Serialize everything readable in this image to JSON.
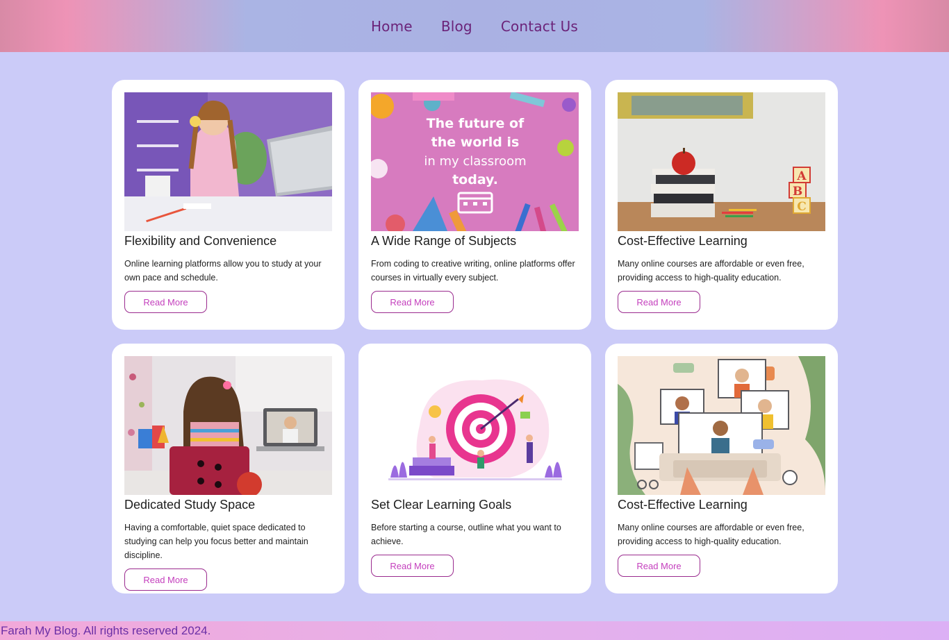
{
  "nav": {
    "items": [
      {
        "label": "Home"
      },
      {
        "label": "Blog"
      },
      {
        "label": "Contact Us"
      }
    ]
  },
  "cards": [
    {
      "title": "Flexibility and Convenience",
      "description": "Online learning platforms allow you to study at your own pace and schedule.",
      "button": "Read More"
    },
    {
      "title": "A Wide Range of Subjects",
      "description": "From coding to creative writing, online platforms offer courses in virtually every subject.",
      "button": "Read More",
      "image_text": [
        "The future of",
        "the world is",
        "in my classroom",
        "today."
      ]
    },
    {
      "title": "Cost-Effective Learning",
      "description": "Many online courses are affordable or even free, providing access to high-quality education.",
      "button": "Read More",
      "image_text": [
        "A",
        "B",
        "C"
      ]
    },
    {
      "title": "Dedicated Study Space",
      "description": "Having a comfortable, quiet space dedicated to studying can help you focus better and maintain discipline.",
      "button": "Read More"
    },
    {
      "title": "Set Clear Learning Goals",
      "description": "Before starting a course, outline what you want to achieve.",
      "button": "Read More"
    },
    {
      "title": "Cost-Effective Learning",
      "description": "Many online courses are affordable or even free, providing access to high-quality education.",
      "button": "Read More"
    }
  ],
  "footer": {
    "text": "Farah My Blog. All rights reserved 2024."
  },
  "colors": {
    "page_background": "#cbcbf8",
    "nav_text": "#6b2379",
    "button_border": "#9a2a8e",
    "button_text": "#c43fbd",
    "footer_text": "#6b2fa6"
  }
}
